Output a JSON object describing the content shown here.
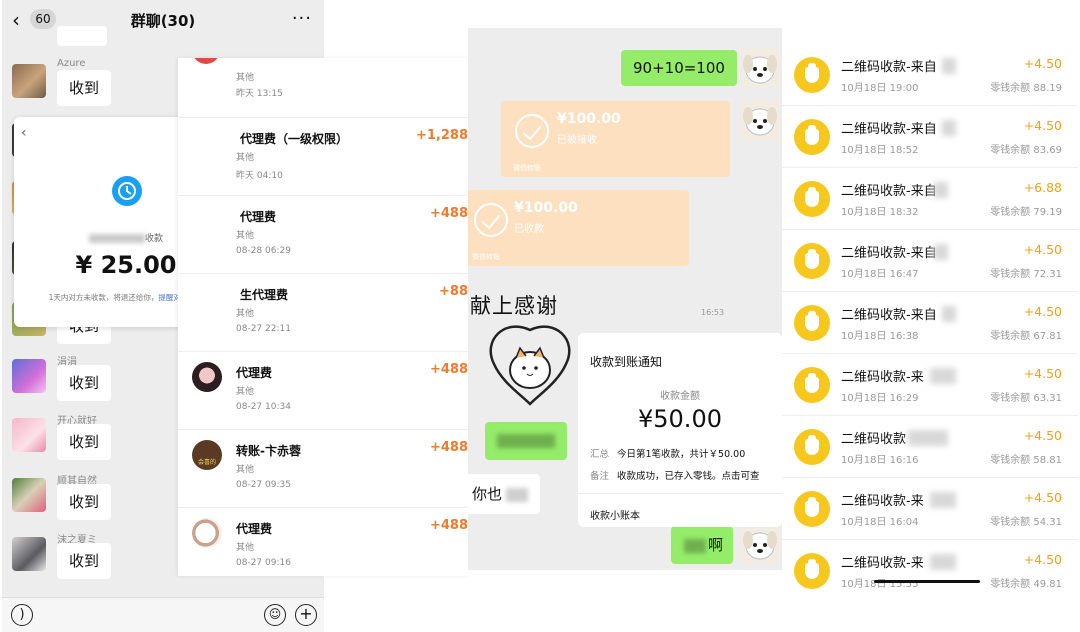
{
  "group_chat": {
    "badge": "60",
    "title": "群聊(30)",
    "more": "···",
    "messages": [
      {
        "name": "Azure",
        "text": "收到"
      },
      {
        "name": "",
        "text": "收到"
      },
      {
        "name": "涓涓",
        "text": "收到"
      },
      {
        "name": "开心就好",
        "text": "收到"
      },
      {
        "name": "顺其自然",
        "text": "收到"
      },
      {
        "name": "沫之夏ミ",
        "text": "收到"
      }
    ],
    "reminder": {
      "payer_suffix": "收款",
      "amount": "¥ 25.00",
      "tip": "1天内对方未收款，将退还给你，",
      "tip_link": "提醒对方收款"
    }
  },
  "bill_list": {
    "items": [
      {
        "name": "",
        "category": "其他",
        "time": "昨天 13:15",
        "amount": ""
      },
      {
        "name": "代理费（一级权限）",
        "category": "其他",
        "time": "昨天 04:10",
        "amount": "+1,288"
      },
      {
        "name": "代理费",
        "category": "其他",
        "time": "08-28 06:29",
        "amount": "+488"
      },
      {
        "name": "生代理费",
        "category": "其他",
        "time": "08-27 22:11",
        "amount": "+88"
      },
      {
        "name": "代理费",
        "category": "其他",
        "time": "08-27 10:34",
        "amount": "+488"
      },
      {
        "name": "转账-卞赤蓉",
        "category": "其他",
        "time": "08-27 09:35",
        "amount": "+488"
      },
      {
        "name": "代理费",
        "category": "其他",
        "time": "08-27 09:16",
        "amount": "+488"
      }
    ],
    "avatar_text": "会喜的"
  },
  "transfer_chat": {
    "msg_math": "90+10=100",
    "transfer1": {
      "amount": "¥100.00",
      "status": "已被接收",
      "footer": "微信转账"
    },
    "transfer2": {
      "amount": "¥100.00",
      "status": "已收款",
      "footer": "微信转账"
    },
    "sticker_text": "献上感谢",
    "timestamp": "16:53",
    "incoming": "你也",
    "outgoing_tail": "啊",
    "notice": {
      "title": "收款到账通知",
      "label": "收款金额",
      "amount": "¥50.00",
      "summary_label": "汇总",
      "summary": "今日第1笔收款，共计￥50.00",
      "remark_label": "备注",
      "remark": "收款成功，已存入零钱。点击可查",
      "footer": "收款小账本"
    }
  },
  "change_list": {
    "rows": [
      {
        "title": "二维码收款-来自",
        "date": "10月18日 19:00",
        "amount": "+4.50",
        "balance": "零钱余额 88.19"
      },
      {
        "title": "二维码收款-来自",
        "date": "10月18日 18:52",
        "amount": "+4.50",
        "balance": "零钱余额 83.69"
      },
      {
        "title": "二维码收款-来自",
        "date": "10月18日 18:32",
        "amount": "+6.88",
        "balance": "零钱余额 79.19"
      },
      {
        "title": "二维码收款-来自",
        "date": "10月18日 16:47",
        "amount": "+4.50",
        "balance": "零钱余额 72.31"
      },
      {
        "title": "二维码收款-来自",
        "date": "10月18日 16:38",
        "amount": "+4.50",
        "balance": "零钱余额 67.81"
      },
      {
        "title": "二维码收款-来",
        "date": "10月18日 16:29",
        "amount": "+4.50",
        "balance": "零钱余额 63.31"
      },
      {
        "title": "二维码收款",
        "date": "10月18日 16:16",
        "amount": "+4.50",
        "balance": "零钱余额 58.81"
      },
      {
        "title": "二维码收款-来",
        "date": "10月18日 16:04",
        "amount": "+4.50",
        "balance": "零钱余额 54.31"
      },
      {
        "title": "二维码收款-来",
        "date": "10月18日 15:55",
        "amount": "+4.50",
        "balance": "零钱余额 49.81"
      }
    ],
    "accent": "#f0a020"
  }
}
